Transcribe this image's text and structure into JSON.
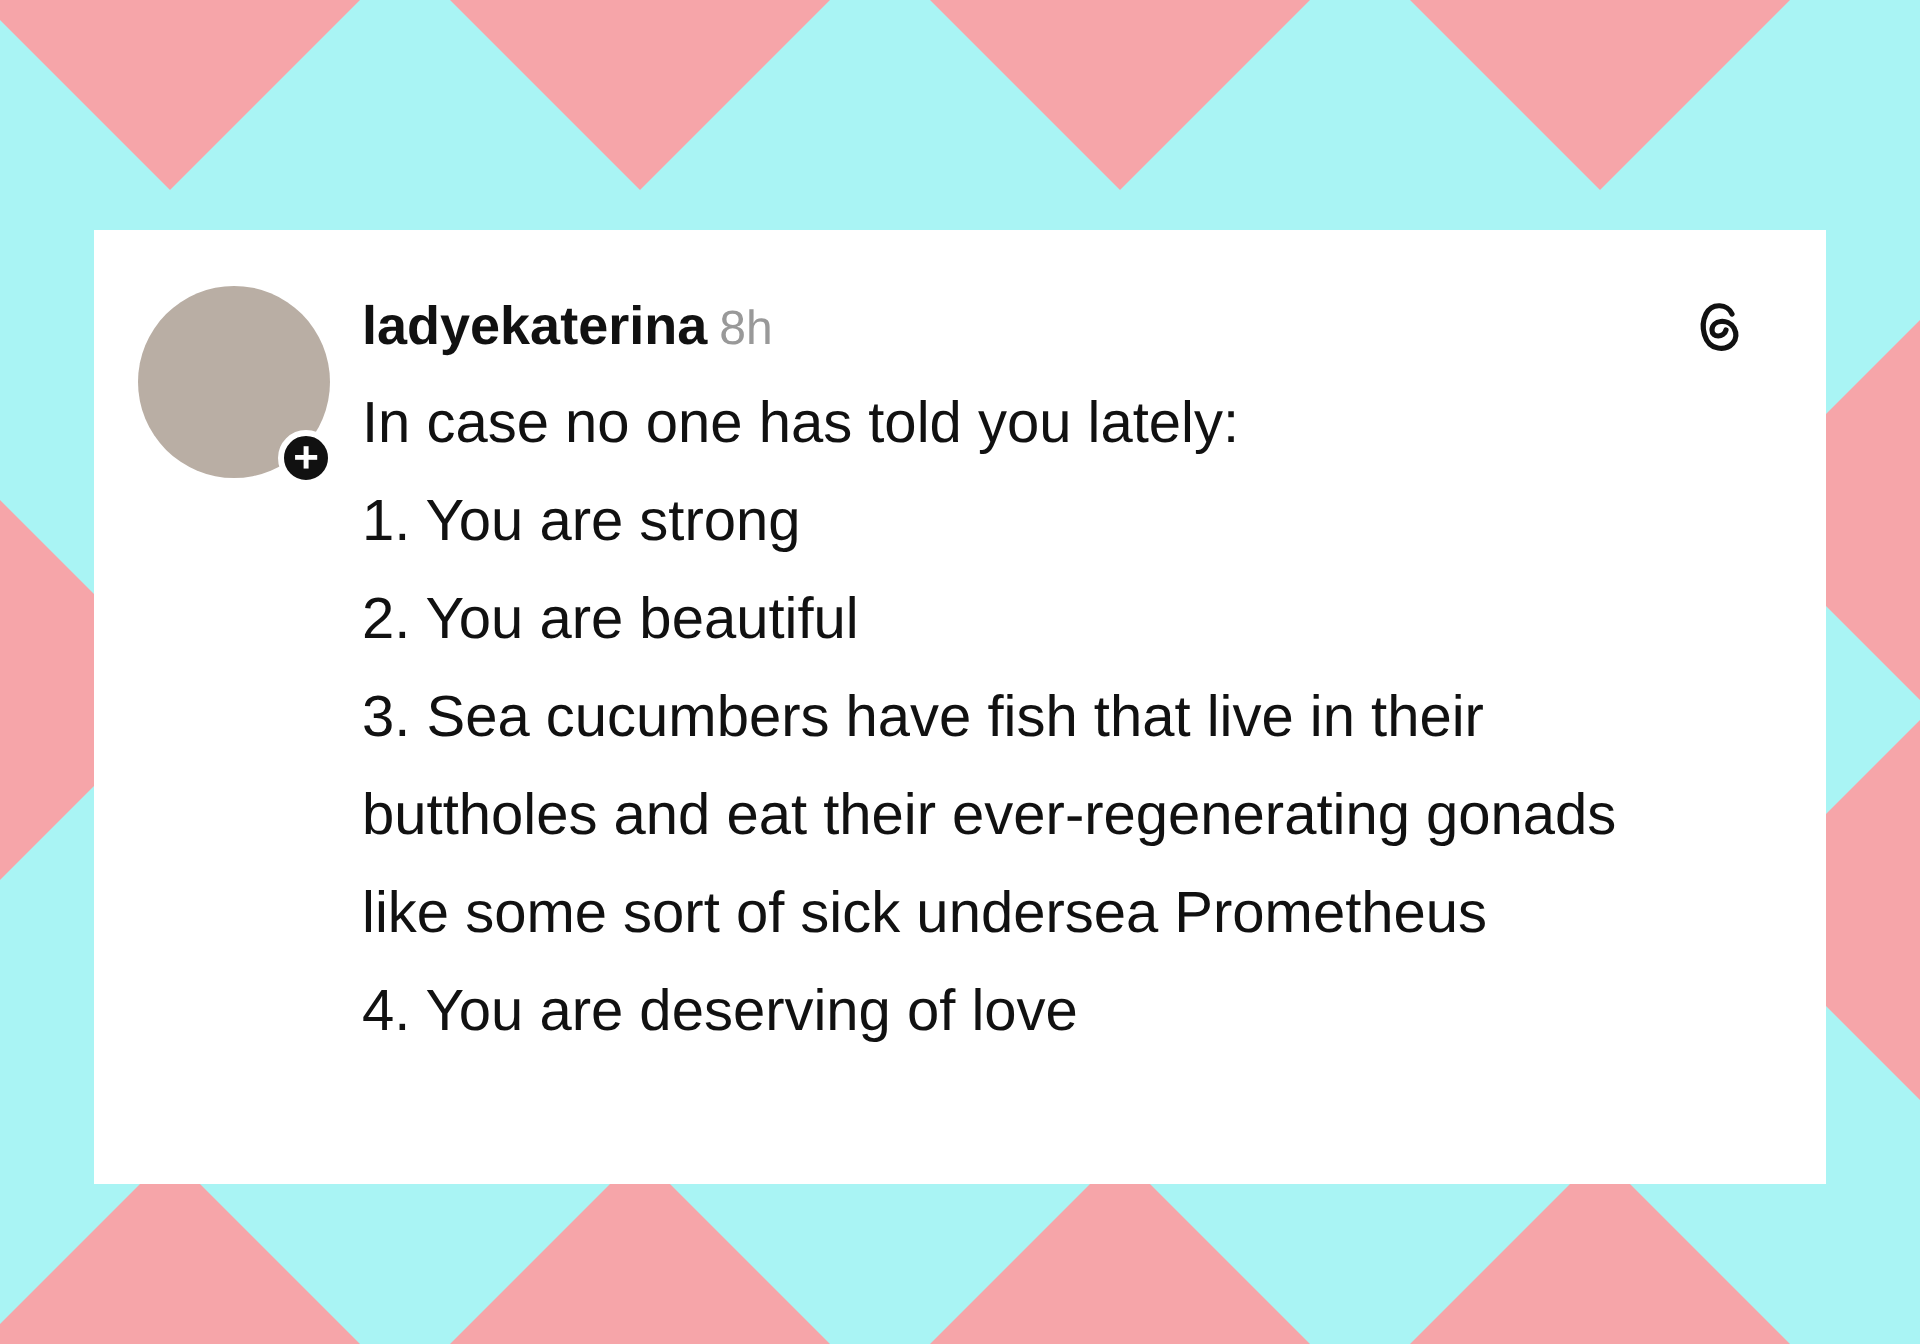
{
  "post": {
    "author": "ladyekaterina",
    "time": "8h",
    "follow_badge": "+",
    "lines": [
      "In case no one has told you lately:",
      "1. You are strong",
      "2. You are beautiful",
      "3. Sea cucumbers have fish that live in their buttholes and eat their ever-regenerating gonads like some sort of sick undersea Prometheus",
      "4. You are deserving of love"
    ]
  }
}
